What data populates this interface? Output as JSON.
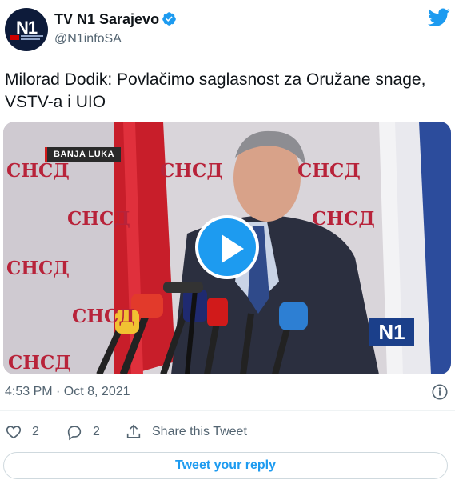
{
  "account": {
    "name": "TV N1 Sarajevo",
    "handle": "@N1infoSA",
    "avatar_text": "N1"
  },
  "tweet": {
    "text": "Milorad Dodik: Povlačimo saglasnost za Oružane snage, VSTV-a i UIO",
    "timestamp": "4:53 PM · Oct 8, 2021"
  },
  "media": {
    "location_label": "BANJA LUKA",
    "backdrop_text": "СНСД",
    "channel_badge": "N1",
    "play_icon": "play-icon"
  },
  "actions": {
    "like_count": "2",
    "reply_count": "2",
    "share_label": "Share this Tweet"
  },
  "reply": {
    "label": "Tweet your reply"
  },
  "colors": {
    "accent": "#1d9bf0",
    "secondary_text": "#536471",
    "primary_text": "#0f1419"
  }
}
